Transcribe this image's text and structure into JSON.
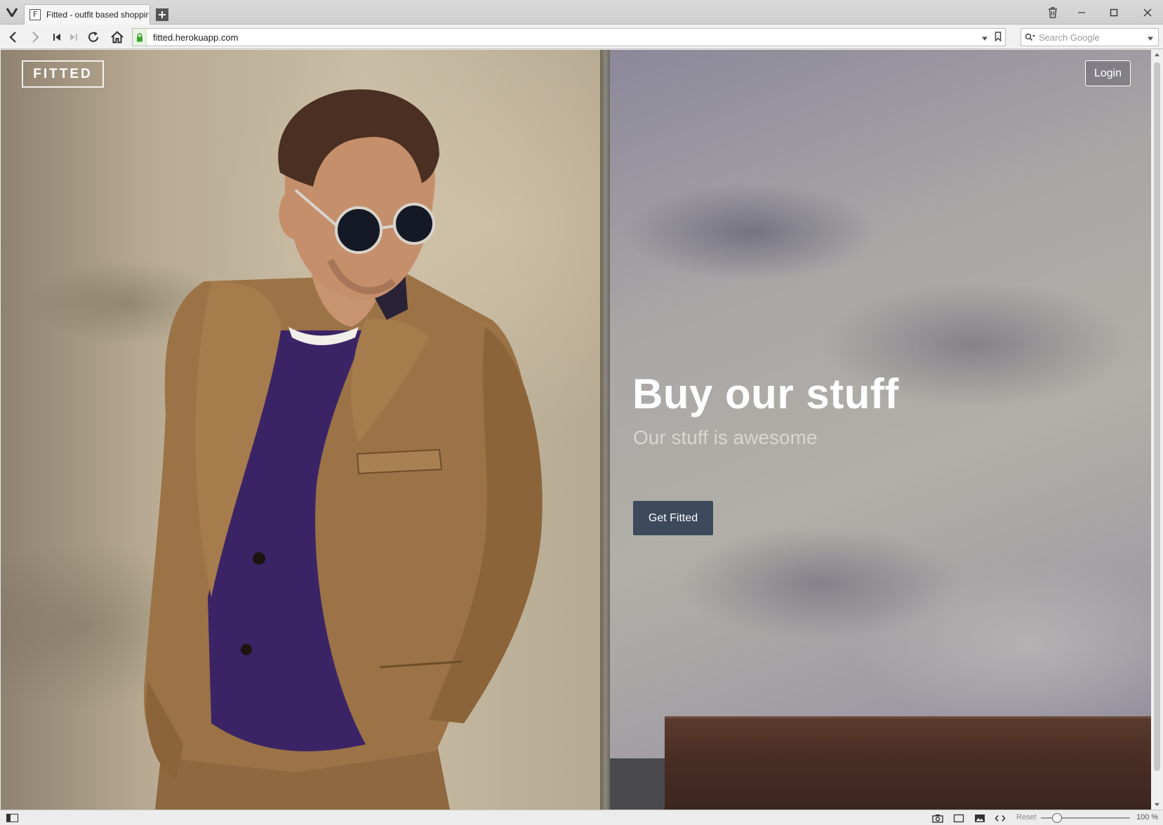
{
  "browser": {
    "tab_title": "Fitted - outfit based shoppin",
    "favicon_letter": "F",
    "url": "fitted.herokuapp.com",
    "search_placeholder": "Search Google",
    "zoom_reset_label": "Reset",
    "zoom_level": "100 %"
  },
  "site": {
    "logo": "FITTED",
    "login_label": "Login",
    "hero_title": "Buy our stuff",
    "hero_subtitle": "Our stuff is awesome",
    "cta_label": "Get Fitted"
  },
  "colors": {
    "cta_background": "#3c4a5c",
    "hero_text": "#ffffff"
  },
  "icons": [
    "vivaldi-logo-icon",
    "new-tab-icon",
    "trash-icon",
    "minimize-icon",
    "maximize-icon",
    "close-icon",
    "back-icon",
    "forward-icon",
    "rewind-icon",
    "fast-forward-icon",
    "reload-icon",
    "home-icon",
    "lock-icon",
    "dropdown-icon",
    "bookmark-icon",
    "search-icon",
    "panel-toggle-icon",
    "camera-icon",
    "window-icon",
    "image-icon",
    "code-icon"
  ]
}
